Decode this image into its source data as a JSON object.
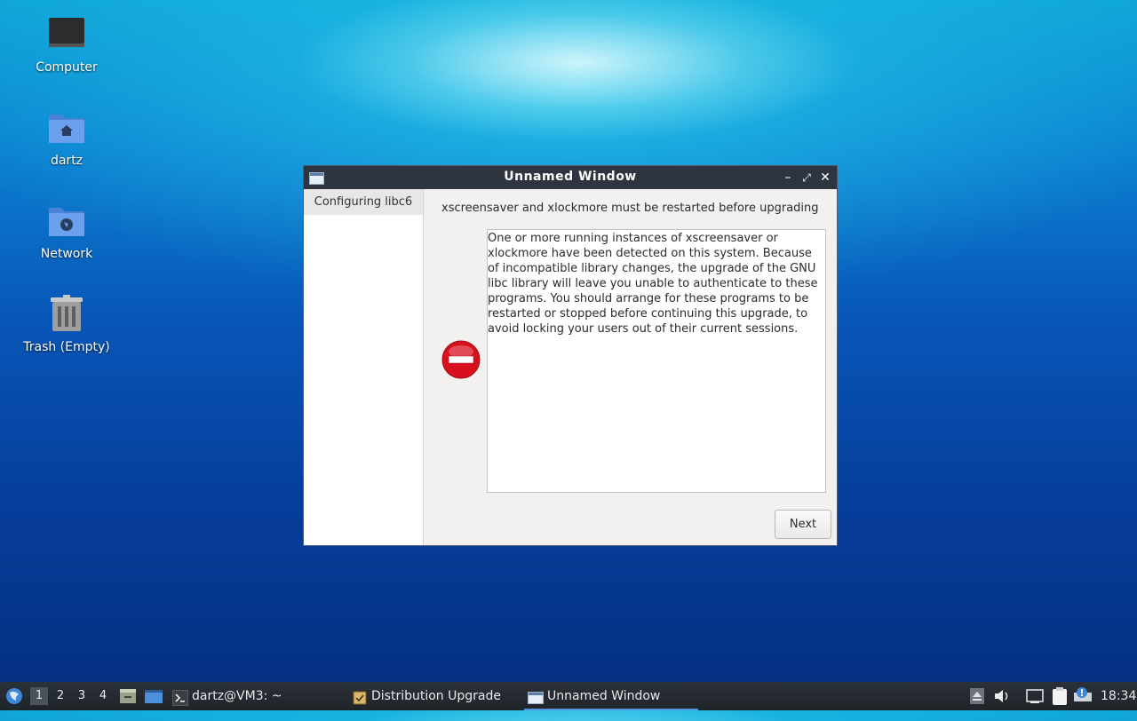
{
  "desktop": {
    "icons": [
      {
        "label": "Computer",
        "icon": "computer-icon"
      },
      {
        "label": "dartz",
        "icon": "home-folder-icon"
      },
      {
        "label": "Network",
        "icon": "network-folder-icon"
      },
      {
        "label": "Trash (Empty)",
        "icon": "trash-icon"
      }
    ]
  },
  "window": {
    "title": "Unnamed Window",
    "controls": {
      "minimize": "–",
      "maximize": "⤢",
      "close": "✕"
    },
    "sidebar": {
      "items": [
        {
          "label": "Configuring libc6"
        }
      ]
    },
    "heading": "xscreensaver and xlockmore must be restarted before upgrading",
    "message": "One or more running instances of xscreensaver or xlockmore have been detected on this system. Because of incompatible library changes, the upgrade of the GNU libc library will leave you unable to authenticate to these programs. You should arrange for these programs to be restarted or stopped before continuing this upgrade, to avoid locking your users out of their current sessions.",
    "message_icon": "stop-icon",
    "next_label": "Next"
  },
  "taskbar": {
    "desktops": [
      "1",
      "2",
      "3",
      "4"
    ],
    "active_desktop": "1",
    "tasks": [
      {
        "label": "dartz@VM3: ~",
        "icon": "terminal-icon"
      },
      {
        "label": "Distribution Upgrade",
        "icon": "package-icon"
      },
      {
        "label": "Unnamed Window",
        "icon": "window-icon",
        "active": true
      }
    ],
    "clock": "18:34"
  },
  "colors": {
    "accent": "#5294e2",
    "titlebar": "#2e3440",
    "stop_red": "#d8101e"
  }
}
